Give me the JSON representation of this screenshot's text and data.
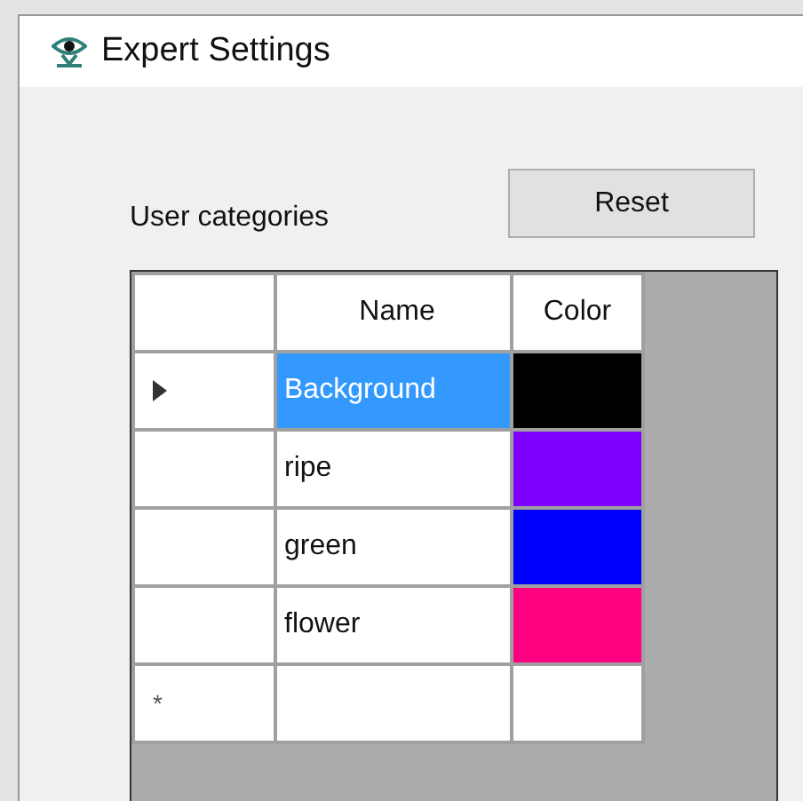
{
  "window": {
    "title": "Expert Settings"
  },
  "label": "User categories",
  "reset_button": "Reset",
  "table": {
    "columns": [
      "Name",
      "Color"
    ],
    "rows": [
      {
        "kind": "item",
        "name": "Background",
        "color": "#000000",
        "selected": true
      },
      {
        "kind": "item",
        "name": "ripe",
        "color": "#8000ff",
        "selected": false
      },
      {
        "kind": "item",
        "name": "green",
        "color": "#0000ff",
        "selected": false
      },
      {
        "kind": "item",
        "name": "flower",
        "color": "#ff0080",
        "selected": false
      },
      {
        "kind": "new",
        "marker": "*"
      }
    ]
  }
}
